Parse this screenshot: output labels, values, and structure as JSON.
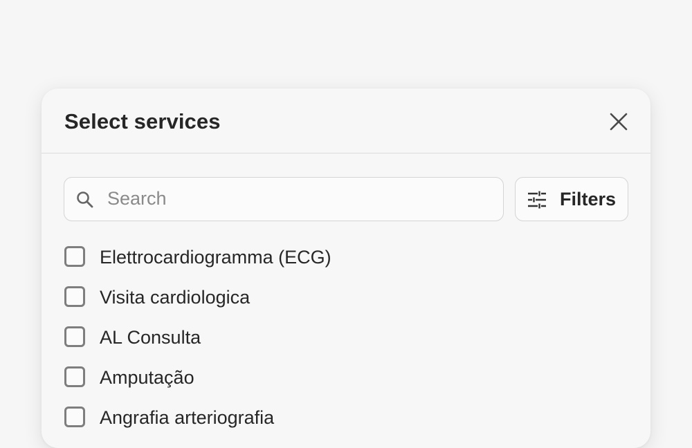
{
  "modal": {
    "title": "Select services",
    "close_icon": "close-icon"
  },
  "search": {
    "placeholder": "Search",
    "value": "",
    "icon": "search-icon"
  },
  "filters": {
    "label": "Filters",
    "icon": "sliders-icon"
  },
  "services": [
    {
      "label": "Elettrocardiogramma (ECG)",
      "checked": false
    },
    {
      "label": "Visita cardiologica",
      "checked": false
    },
    {
      "label": "AL Consulta",
      "checked": false
    },
    {
      "label": "Amputação",
      "checked": false
    },
    {
      "label": "Angrafia arteriografia",
      "checked": false
    }
  ],
  "colors": {
    "background": "#f6f6f6",
    "text": "#262626",
    "placeholder": "#8a8a8a",
    "border": "#d4d4d4",
    "checkbox_border": "#7e7e7e"
  }
}
